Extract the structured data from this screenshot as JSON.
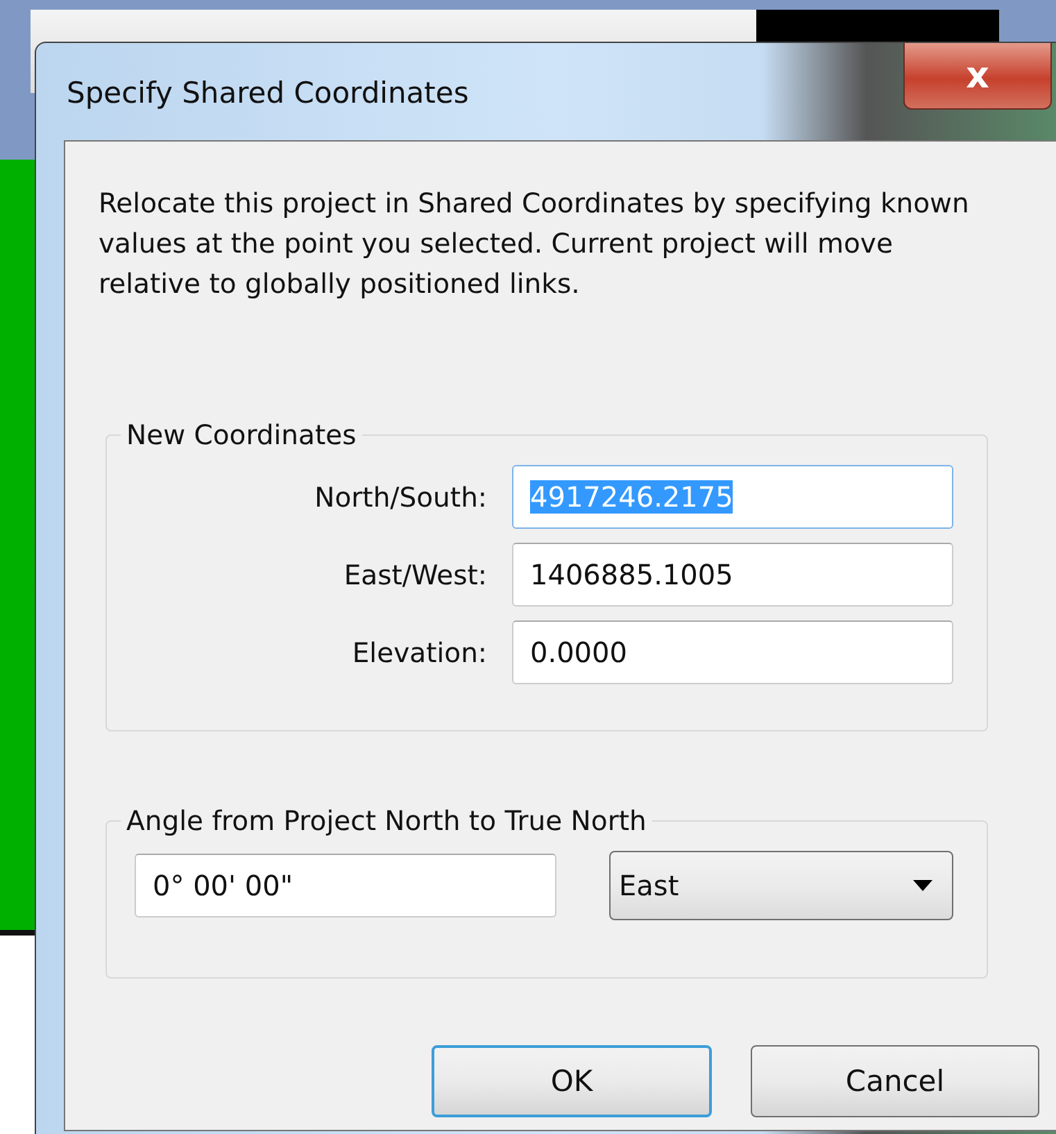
{
  "window": {
    "title": "Specify Shared Coordinates",
    "close_glyph": "x"
  },
  "description": "Relocate this project in Shared Coordinates by specifying known values at the point you selected. Current project will move relative to globally positioned links.",
  "new_coordinates": {
    "title": "New Coordinates",
    "fields": [
      {
        "label": "North/South:",
        "value": "4917246.2175",
        "text_selected": true
      },
      {
        "label": "East/West:",
        "value": "1406885.1005",
        "text_selected": false
      },
      {
        "label": "Elevation:",
        "value": "0.0000",
        "text_selected": false
      }
    ]
  },
  "angle": {
    "title": "Angle from Project North to True North",
    "value": "0° 00' 00\"",
    "direction": "East"
  },
  "buttons": [
    {
      "label": "OK",
      "default": true
    },
    {
      "label": "Cancel",
      "default": false
    }
  ]
}
